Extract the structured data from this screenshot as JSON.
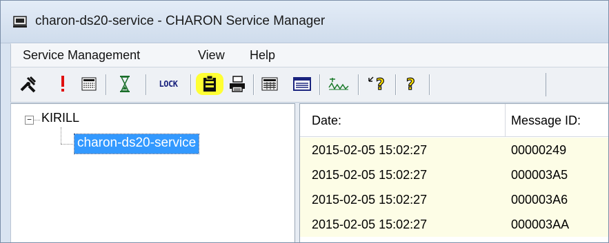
{
  "window": {
    "title": "charon-ds20-service - CHARON Service Manager",
    "app_icon": "computer-monitor-icon"
  },
  "menu": [
    {
      "label": "Service Management"
    },
    {
      "label": "View"
    },
    {
      "label": "Help"
    }
  ],
  "toolbar": {
    "buttons": [
      {
        "icon": "tools-icon"
      },
      {
        "icon": "alert-icon"
      },
      {
        "icon": "grid-list-icon"
      },
      {
        "icon": "hourglass-icon"
      },
      {
        "icon": "lock-icon",
        "text": "LOCK"
      },
      {
        "icon": "clipboard-icon",
        "highlighted": true
      },
      {
        "icon": "printer-icon"
      },
      {
        "icon": "grid-view-icon"
      },
      {
        "icon": "window-icon"
      },
      {
        "icon": "waveform-icon"
      },
      {
        "icon": "context-help-icon"
      },
      {
        "icon": "help-icon"
      }
    ],
    "highlight_color": "#ffff33"
  },
  "tree": {
    "root": {
      "label": "KIRILL",
      "expanded": true,
      "toggle": "−"
    },
    "children": [
      {
        "label": "charon-ds20-service",
        "selected": true
      }
    ],
    "selection_color": "#3399ff"
  },
  "log_table": {
    "columns": [
      "Date:",
      "Message ID:"
    ],
    "rows": [
      [
        "2015-02-05 15:02:27",
        "00000249"
      ],
      [
        "2015-02-05 15:02:27",
        "000003A5"
      ],
      [
        "2015-02-05 15:02:27",
        "000003A6"
      ],
      [
        "2015-02-05 15:02:27",
        "000003AA"
      ]
    ],
    "row_color": "#fdfde6"
  }
}
